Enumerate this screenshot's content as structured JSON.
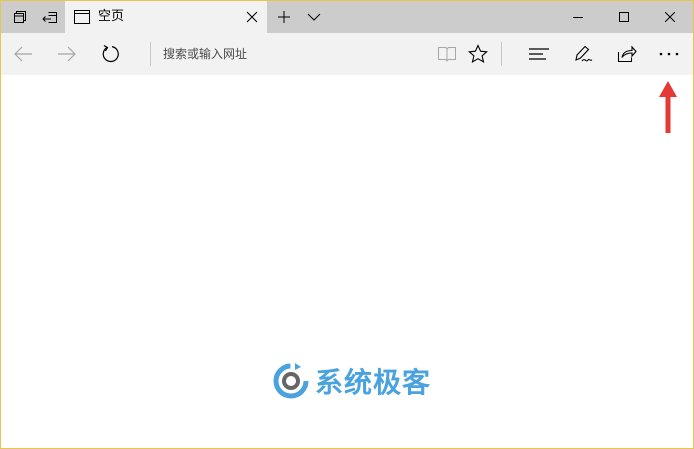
{
  "colors": {
    "titlebar_bg": "#cccccc",
    "toolbar_bg": "#f2f2f2",
    "window_border": "#e8c54e",
    "arrow_red": "#e53935",
    "watermark_blue": "#4aa3df",
    "watermark_gray": "#666666"
  },
  "titlebar": {
    "icons": [
      "tab-set-aside-icon",
      "tabs-aside-icon"
    ],
    "new_tab_icon": "plus-icon",
    "tab_preview_icon": "chevron-down-icon",
    "window_controls": [
      "minimize-icon",
      "maximize-icon",
      "close-icon"
    ]
  },
  "tab": {
    "title": "空页",
    "icon": "blank-page-icon",
    "close_icon": "close-icon"
  },
  "toolbar": {
    "back_icon": "arrow-left-icon",
    "forward_icon": "arrow-right-icon",
    "refresh_icon": "refresh-icon",
    "address_placeholder": "搜索或输入网址",
    "reading_view_icon": "book-icon",
    "favorite_icon": "star-icon",
    "hub_icon": "hub-lines-icon",
    "web_note_icon": "pen-icon",
    "share_icon": "share-icon",
    "more_icon": "more-dots-icon",
    "more_label": "···"
  },
  "annotation": {
    "arrow_icon": "red-arrow-up-icon"
  },
  "watermark": {
    "text": "系统极客",
    "logo_icon": "gear-logo-icon"
  }
}
